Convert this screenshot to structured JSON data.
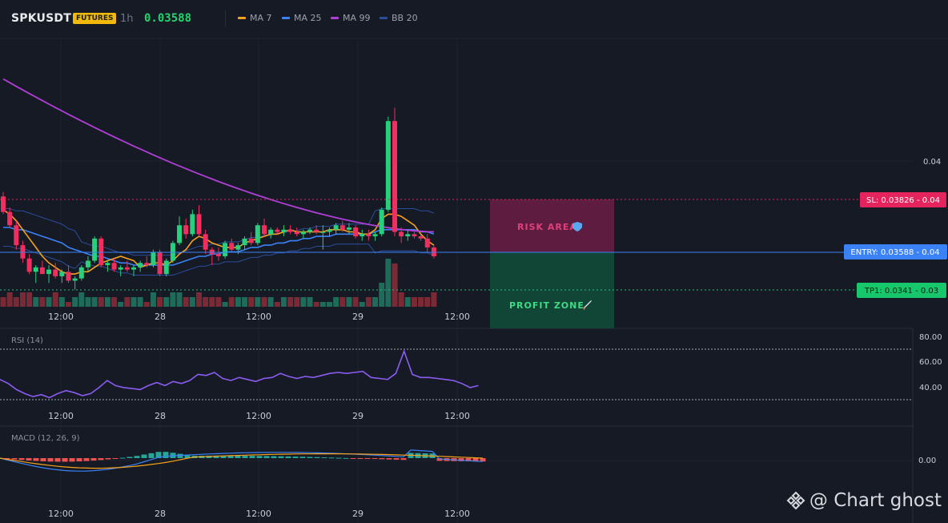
{
  "header": {
    "symbol": "SPKUSDT",
    "badge": "FUTURES",
    "timeframe": "1h",
    "price": "0.03588",
    "legend": [
      {
        "label": "MA 7",
        "color": "#f7a21b"
      },
      {
        "label": "MA 25",
        "color": "#3b82f6"
      },
      {
        "label": "MA 99",
        "color": "#b03fd8"
      },
      {
        "label": "BB 20",
        "color": "#2a4d9c"
      }
    ]
  },
  "levels": {
    "sl_label": "SL: 0.03826 - 0.04",
    "entry_label": "ENTRY: 0.03588 - 0.04",
    "tp_label": "TP1: 0.0341 - 0.03",
    "risk_label": "RISK AREA",
    "profit_label": "PROFIT ZONE"
  },
  "chart_data": [
    {
      "type": "candlestick",
      "title": "SPKUSDT 1h",
      "x_tick_labels": [
        "12:00",
        "28",
        "12:00",
        "29",
        "12:00"
      ],
      "y_tick_labels": [
        "0.04"
      ],
      "indicators": [
        "MA 7",
        "MA 25",
        "MA 99",
        "BB 20"
      ],
      "ohlc": [
        [
          0.0384,
          0.0386,
          0.0376,
          0.0377
        ],
        [
          0.0377,
          0.0379,
          0.037,
          0.0371
        ],
        [
          0.0371,
          0.0373,
          0.036,
          0.0362
        ],
        [
          0.0362,
          0.0364,
          0.0354,
          0.0356
        ],
        [
          0.0356,
          0.0358,
          0.0349,
          0.035
        ],
        [
          0.035,
          0.0353,
          0.0345,
          0.0352
        ],
        [
          0.0352,
          0.0355,
          0.0349,
          0.0349
        ],
        [
          0.0349,
          0.0353,
          0.0345,
          0.0351
        ],
        [
          0.0351,
          0.0354,
          0.0347,
          0.0348
        ],
        [
          0.0348,
          0.0351,
          0.0345,
          0.035
        ],
        [
          0.035,
          0.0353,
          0.0345,
          0.0346
        ],
        [
          0.0346,
          0.0348,
          0.0342,
          0.0347
        ],
        [
          0.0347,
          0.0353,
          0.0346,
          0.0352
        ],
        [
          0.0352,
          0.0357,
          0.035,
          0.0355
        ],
        [
          0.0355,
          0.0366,
          0.0354,
          0.0365
        ],
        [
          0.0365,
          0.0366,
          0.0352,
          0.0353
        ],
        [
          0.0353,
          0.0355,
          0.035,
          0.0354
        ],
        [
          0.0354,
          0.0356,
          0.035,
          0.0351
        ],
        [
          0.0351,
          0.0353,
          0.0348,
          0.0352
        ],
        [
          0.0352,
          0.0355,
          0.035,
          0.0351
        ],
        [
          0.0351,
          0.0353,
          0.0348,
          0.0352
        ],
        [
          0.0352,
          0.0355,
          0.035,
          0.0354
        ],
        [
          0.0354,
          0.0357,
          0.0352,
          0.0353
        ],
        [
          0.0353,
          0.036,
          0.0352,
          0.0359
        ],
        [
          0.0359,
          0.036,
          0.0348,
          0.0349
        ],
        [
          0.0349,
          0.0356,
          0.0348,
          0.0355
        ],
        [
          0.0355,
          0.0364,
          0.0354,
          0.0363
        ],
        [
          0.0363,
          0.0375,
          0.0362,
          0.0371
        ],
        [
          0.0371,
          0.0374,
          0.0365,
          0.0367
        ],
        [
          0.0367,
          0.0378,
          0.0366,
          0.0376
        ],
        [
          0.0376,
          0.038,
          0.0366,
          0.0367
        ],
        [
          0.0367,
          0.0369,
          0.0358,
          0.036
        ],
        [
          0.036,
          0.0361,
          0.0353,
          0.0358
        ],
        [
          0.0358,
          0.0361,
          0.0355,
          0.0357
        ],
        [
          0.0357,
          0.0364,
          0.0356,
          0.0363
        ],
        [
          0.0363,
          0.0365,
          0.0359,
          0.036
        ],
        [
          0.036,
          0.0363,
          0.0358,
          0.0362
        ],
        [
          0.0362,
          0.0366,
          0.036,
          0.0365
        ],
        [
          0.0365,
          0.0368,
          0.0362,
          0.0363
        ],
        [
          0.0363,
          0.0372,
          0.0362,
          0.0371
        ],
        [
          0.0371,
          0.0374,
          0.0366,
          0.0367
        ],
        [
          0.0367,
          0.037,
          0.0365,
          0.0369
        ],
        [
          0.0369,
          0.037,
          0.0367,
          0.0368
        ],
        [
          0.0368,
          0.0371,
          0.0366,
          0.0369
        ],
        [
          0.0369,
          0.0371,
          0.0367,
          0.0368
        ],
        [
          0.0368,
          0.037,
          0.0366,
          0.0367
        ],
        [
          0.0367,
          0.0369,
          0.0365,
          0.0368
        ],
        [
          0.0368,
          0.037,
          0.0367,
          0.0369
        ],
        [
          0.0369,
          0.0371,
          0.0367,
          0.0368
        ],
        [
          0.0368,
          0.0371,
          0.036,
          0.0368
        ],
        [
          0.0368,
          0.037,
          0.0366,
          0.0369
        ],
        [
          0.0369,
          0.0372,
          0.0367,
          0.0371
        ],
        [
          0.0371,
          0.0373,
          0.0368,
          0.0369
        ],
        [
          0.0369,
          0.0372,
          0.0367,
          0.037
        ],
        [
          0.037,
          0.0371,
          0.0365,
          0.0366
        ],
        [
          0.0366,
          0.0369,
          0.0364,
          0.0367
        ],
        [
          0.0367,
          0.0369,
          0.0364,
          0.0366
        ],
        [
          0.0366,
          0.0368,
          0.0364,
          0.0367
        ],
        [
          0.0367,
          0.0379,
          0.0366,
          0.0378
        ],
        [
          0.0378,
          0.042,
          0.0377,
          0.0418
        ],
        [
          0.0418,
          0.0424,
          0.0366,
          0.0368
        ],
        [
          0.0368,
          0.037,
          0.0363,
          0.0366
        ],
        [
          0.0366,
          0.0369,
          0.0364,
          0.0367
        ],
        [
          0.0367,
          0.0368,
          0.0365,
          0.0366
        ],
        [
          0.0366,
          0.0367,
          0.0364,
          0.0365
        ],
        [
          0.0365,
          0.0367,
          0.0359,
          0.0361
        ],
        [
          0.0361,
          0.0362,
          0.0356,
          0.0357
        ]
      ],
      "volume": [
        2,
        3,
        2,
        3,
        3,
        2,
        2,
        2,
        3,
        2,
        1,
        2,
        3,
        2,
        2,
        2,
        2,
        2,
        1,
        2,
        2,
        2,
        1,
        3,
        2,
        2,
        3,
        3,
        2,
        2,
        3,
        2,
        2,
        2,
        1,
        2,
        2,
        2,
        2,
        2,
        2,
        2,
        1,
        2,
        2,
        2,
        2,
        2,
        1,
        1,
        1,
        2,
        2,
        2,
        2,
        1,
        2,
        2,
        5,
        10,
        9,
        3,
        2,
        2,
        2,
        2,
        3
      ],
      "ma7": [
        0.0378,
        0.0376,
        0.0373,
        0.0369,
        0.0365,
        0.0361,
        0.0357,
        0.0354,
        0.0352,
        0.035,
        0.0349,
        0.0349,
        0.035,
        0.035,
        0.0352,
        0.0354,
        0.0355,
        0.0356,
        0.0357,
        0.0356,
        0.0355,
        0.0352,
        0.0353,
        0.0354,
        0.0354,
        0.0353,
        0.0355,
        0.0358,
        0.036,
        0.0364,
        0.0366,
        0.0365,
        0.0363,
        0.0362,
        0.0361,
        0.0361,
        0.0361,
        0.0363,
        0.0364,
        0.0365,
        0.0366,
        0.0367,
        0.0367,
        0.0368,
        0.0369,
        0.0368,
        0.0368,
        0.0368,
        0.0368,
        0.0368,
        0.0369,
        0.0369,
        0.0369,
        0.0368,
        0.0368,
        0.0367,
        0.0367,
        0.0369,
        0.0374,
        0.0376,
        0.0376,
        0.0375,
        0.0373,
        0.0371,
        0.0367,
        0.0364,
        0.0362
      ],
      "ma25": [
        0.037,
        0.037,
        0.0369,
        0.0369,
        0.0368,
        0.0367,
        0.0366,
        0.0365,
        0.0364,
        0.0363,
        0.0361,
        0.036,
        0.0359,
        0.0358,
        0.0357,
        0.0357,
        0.0356,
        0.0355,
        0.0354,
        0.0354,
        0.0353,
        0.0353,
        0.0353,
        0.0353,
        0.0353,
        0.0353,
        0.0353,
        0.0354,
        0.0355,
        0.0356,
        0.0357,
        0.0357,
        0.0358,
        0.0358,
        0.0359,
        0.0359,
        0.0359,
        0.036,
        0.0361,
        0.0361,
        0.0362,
        0.0362,
        0.0363,
        0.0363,
        0.0364,
        0.0364,
        0.0365,
        0.0365,
        0.0366,
        0.0366,
        0.0366,
        0.0367,
        0.0367,
        0.0367,
        0.0367,
        0.0367,
        0.0367,
        0.0368,
        0.0369,
        0.0369,
        0.0369,
        0.0369,
        0.0369,
        0.0369,
        0.0368,
        0.0368,
        0.0367
      ],
      "ma99_start_end": [
        0.0437,
        0.0368
      ]
    },
    {
      "type": "line",
      "title": "RSI (14)",
      "y_tick_labels": [
        "80.00",
        "60.00",
        "40.00"
      ],
      "ylim": [
        25,
        85
      ],
      "values": [
        50,
        46,
        40,
        36,
        33,
        35,
        32,
        36,
        39,
        37,
        34,
        36,
        42,
        49,
        44,
        42,
        41,
        40,
        44,
        47,
        44,
        48,
        46,
        49,
        55,
        54,
        57,
        51,
        49,
        52,
        50,
        48,
        51,
        52,
        56,
        53,
        51,
        53,
        52,
        54,
        56,
        57,
        56,
        57,
        58,
        52,
        51,
        50,
        56,
        78,
        55,
        52,
        52,
        51,
        50,
        49,
        46,
        42,
        44
      ]
    },
    {
      "type": "bar",
      "title": "MACD (12, 26, 9)",
      "y_tick_labels": [
        "0.00"
      ]
    }
  ],
  "x_axis": [
    "12:00",
    "28",
    "12:00",
    "29",
    "12:00"
  ],
  "watermark": "@ Chart ghost"
}
